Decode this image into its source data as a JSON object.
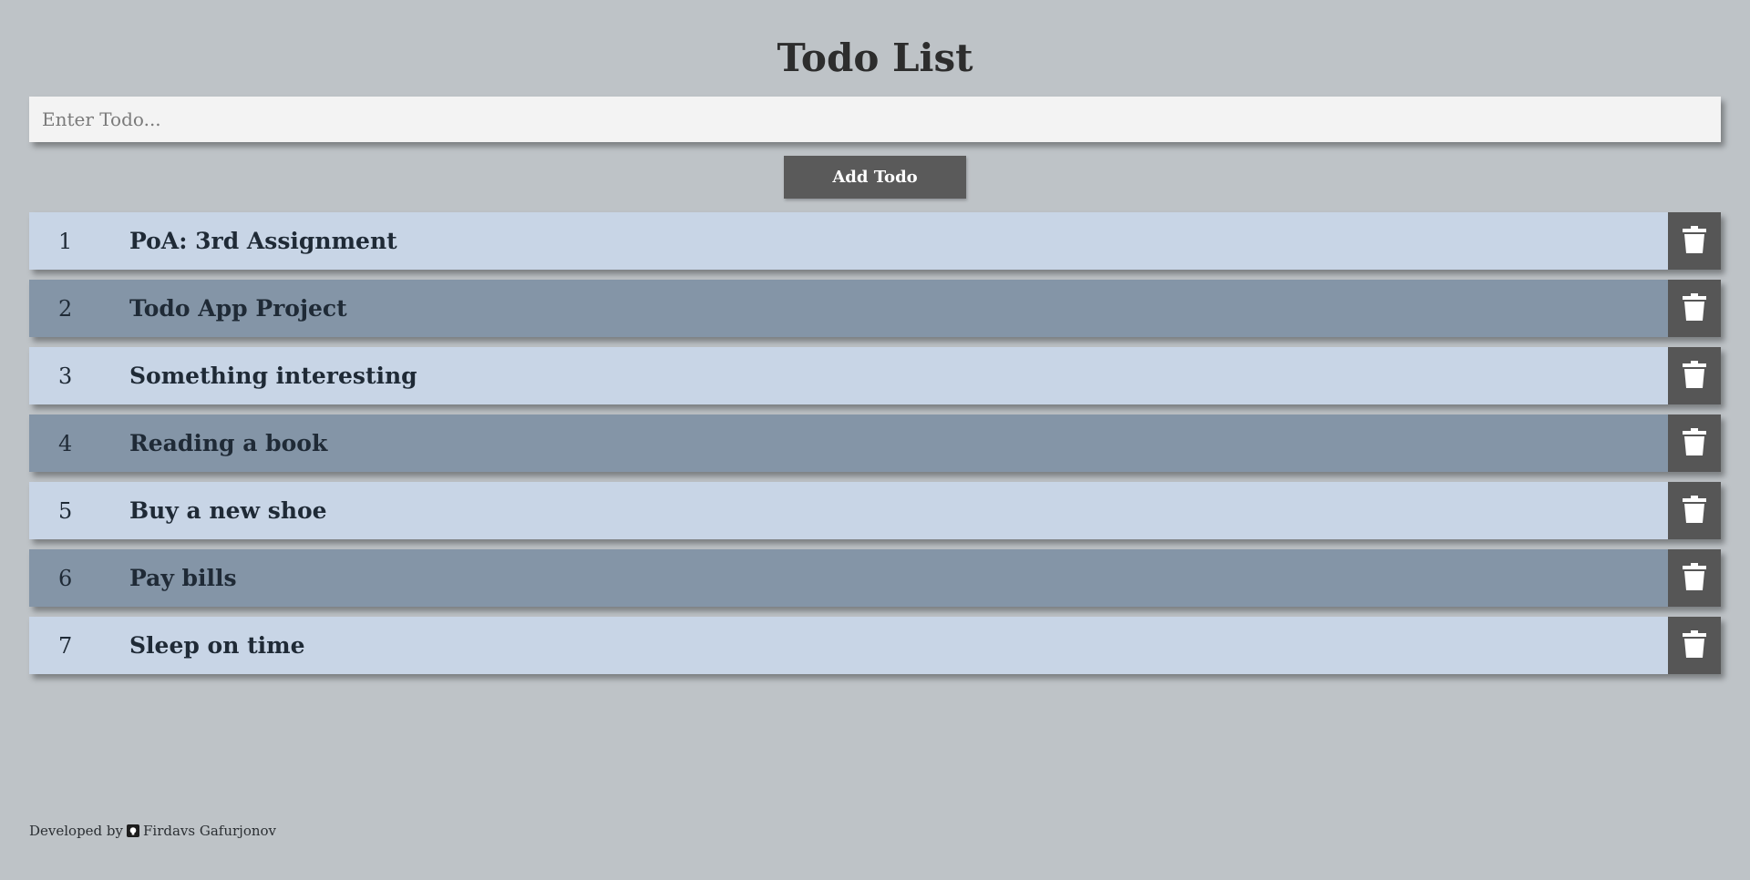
{
  "header": {
    "title": "Todo List"
  },
  "form": {
    "input_placeholder": "Enter Todo...",
    "input_value": "",
    "add_button_label": "Add Todo"
  },
  "todos": [
    {
      "number": "1",
      "text": "PoA: 3rd Assignment",
      "tone": "light"
    },
    {
      "number": "2",
      "text": "Todo App Project",
      "tone": "dark"
    },
    {
      "number": "3",
      "text": "Something interesting",
      "tone": "light"
    },
    {
      "number": "4",
      "text": "Reading a book",
      "tone": "dark"
    },
    {
      "number": "5",
      "text": "Buy a new shoe",
      "tone": "light"
    },
    {
      "number": "6",
      "text": "Pay bills",
      "tone": "dark"
    },
    {
      "number": "7",
      "text": "Sleep on time",
      "tone": "light"
    }
  ],
  "row_icon": "trash-icon",
  "footer": {
    "prefix": "Developed by",
    "icon": "github-icon",
    "author": "Firdavs Gafurjonov"
  },
  "colors": {
    "background": "#bec3c7",
    "row_light": "#c8d5e6",
    "row_dark": "#8495a7",
    "button": "#5a5a5a"
  }
}
